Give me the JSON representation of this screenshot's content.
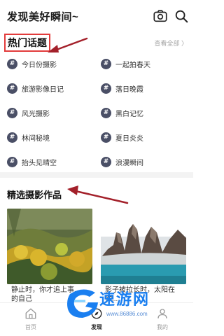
{
  "header": {
    "title": "发现美好瞬间~",
    "camera_icon": "camera-icon",
    "search_icon": "search-icon"
  },
  "hot_topics": {
    "title": "热门话题",
    "see_all": "查看全部 〉",
    "hash_symbol": "#",
    "highlight_color": "#e23b3b",
    "items": [
      {
        "label": "今日份摄影"
      },
      {
        "label": "一起拍春天"
      },
      {
        "label": "旅游影像日记"
      },
      {
        "label": "落日晚霞"
      },
      {
        "label": "风光摄影"
      },
      {
        "label": "黑白记忆"
      },
      {
        "label": "林间秘境"
      },
      {
        "label": "夏日炎炎"
      },
      {
        "label": "抬头见晴空"
      },
      {
        "label": "浪漫瞬间"
      }
    ]
  },
  "featured": {
    "title": "精选摄影作品",
    "cards": [
      {
        "caption": "静止时，你才追上事......的自己"
      },
      {
        "caption": "影子被拉长时，太阳在你..."
      }
    ]
  },
  "bottom_nav": {
    "items": [
      {
        "label": "首页",
        "icon": "home-icon"
      },
      {
        "label": "发现",
        "icon": "discover-icon"
      },
      {
        "label": "我的",
        "icon": "profile-icon"
      }
    ]
  },
  "watermark": {
    "text": "速游网",
    "url": "www.86886.com"
  },
  "colors": {
    "accent_arrow": "#a3202a",
    "hash_badge": "#4a4f66",
    "watermark": "#1a7ff0"
  }
}
